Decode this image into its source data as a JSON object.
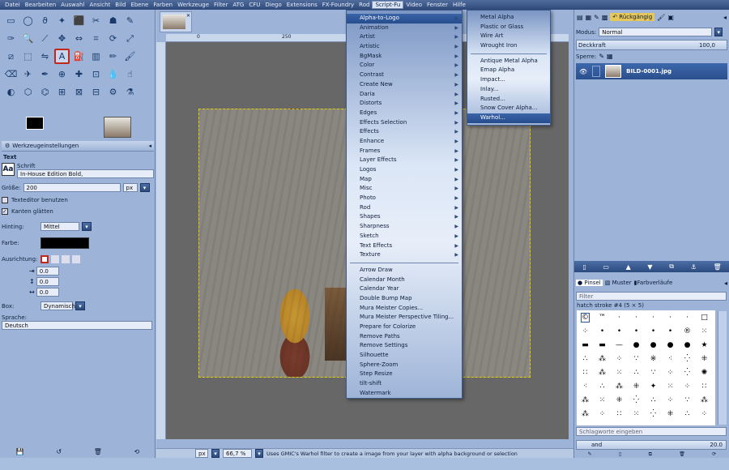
{
  "menubar": [
    "Datei",
    "Bearbeiten",
    "Auswahl",
    "Ansicht",
    "Bild",
    "Ebene",
    "Farben",
    "Werkzeuge",
    "Filter",
    "ATG",
    "CFU",
    "Diego",
    "Extensions",
    "FX-Foundry",
    "Rod",
    "Script-Fu",
    "Video",
    "Fenster",
    "Hilfe"
  ],
  "tool_icons": [
    "rect-select-icon",
    "ellipse-select-icon",
    "lasso-icon",
    "fuzzy-select-icon",
    "color-select-icon",
    "scissors-icon",
    "foreground-select-icon",
    "paths-icon",
    "color-picker-icon",
    "zoom-icon",
    "measure-icon",
    "move-icon",
    "align-icon",
    "crop-icon",
    "rotate-icon",
    "scale-icon",
    "shear-icon",
    "perspective-icon",
    "flip-icon",
    "text-icon",
    "bucket-fill-icon",
    "blend-icon",
    "pencil-icon",
    "paintbrush-icon",
    "eraser-icon",
    "airbrush-icon",
    "ink-icon",
    "clone-icon",
    "heal-icon",
    "perspective-clone-icon",
    "blur-icon",
    "smudge-icon",
    "dodge-burn-icon",
    "cage-icon",
    "warp-icon",
    "unified-transform-icon",
    "handle-transform-icon",
    "seamless-clone-icon",
    "gegl-icon",
    "filter-icon"
  ],
  "tool_glyphs": [
    "▭",
    "◯",
    "ϑ",
    "✦",
    "⬛",
    "✂",
    "☗",
    "✎",
    "✑",
    "🔍",
    "⟋",
    "✥",
    "⇔",
    "⌗",
    "⟳",
    "⤢",
    "⧄",
    "⬚",
    "⇋",
    "A",
    "⛽",
    "▥",
    "✏",
    "🖌",
    "⌫",
    "✈",
    "✒",
    "⊕",
    "✚",
    "⊡",
    "💧",
    "☝",
    "◐",
    "⬡",
    "⌬",
    "⊞",
    "⊠",
    "⊟",
    "⚙",
    "⚗"
  ],
  "tool_options": {
    "tab_label": "Werkzeugeinstellungen",
    "section": "Text",
    "font_label": "Schrift",
    "font_value": "In-House Edition Bold,",
    "size_label": "Größe:",
    "size_value": "200",
    "size_unit": "px",
    "use_editor": "Texteditor benutzen",
    "antialias": "Kanten glätten",
    "hinting_label": "Hinting:",
    "hinting_value": "Mittel",
    "color_label": "Farbe:",
    "justify_label": "Ausrichtung:",
    "indent_value": "0.0",
    "linespacing_value": "0.0",
    "letterspacing_value": "0.0",
    "box_label": "Box:",
    "box_value": "Dynamisch",
    "language_label": "Sprache:",
    "language_value": "Deutsch"
  },
  "ruler": {
    "t0": "0",
    "t250": "250"
  },
  "status": {
    "unit": "px",
    "zoom": "66,7 %",
    "message": "Uses GMIC's Warhol filter to create a image from your layer with alpha background or selection"
  },
  "scriptfu_menu": [
    "Alpha-to-Logo",
    "Animation",
    "Artist",
    "Artistic",
    "BgMask",
    "Color",
    "Contrast",
    "Create New",
    "Daria",
    "Distorts",
    "Edges",
    "Effects Selection",
    "Effects",
    "Enhance",
    "Frames",
    "Layer Effects",
    "Logos",
    "Map",
    "Misc",
    "Photo",
    "Rod",
    "Shapes",
    "Sharpness",
    "Sketch",
    "Text Effects",
    "Texture"
  ],
  "scriptfu_menu2": [
    "Arrow Draw",
    "Calendar Month",
    "Calendar Year",
    "Double Bump Map",
    "Mura Meister Copies...",
    "Mura Meister Perspective Tiling...",
    "Prepare for Colorize",
    "Remove Paths",
    "Remove Settings",
    "Silhouette",
    "Sphere-Zoom",
    "Step Resize",
    "tilt-shift",
    "Watermark"
  ],
  "submenu_a": [
    "Metal Alpha",
    "Plastic or Glass",
    "Wire Art",
    "Wrought Iron"
  ],
  "submenu_b": [
    "Antique Metal Alpha",
    "Emap Alpha",
    "Impact...",
    "Inlay...",
    "Rusted...",
    "Snow Cover Alpha...",
    "Warhol..."
  ],
  "layers": {
    "undo_label": "Rückgängig",
    "mode_label": "Modus:",
    "mode_value": "Normal",
    "opacity_label": "Deckkraft",
    "opacity_value": "100,0",
    "lock_label": "Sperre:",
    "layer_name": "BILD-0001.jpg"
  },
  "brushes": {
    "tabs": [
      "Pinsel",
      "Muster",
      "Farbverläufe"
    ],
    "filter_placeholder": "Filter",
    "brush_name": "hatch stroke #4 (5 × 5)",
    "tag_placeholder": "Schlagworte eingeben",
    "spacing_value": "and",
    "spacing_num": "20.0"
  },
  "colors": {
    "accent": "#c0281c",
    "menu_highlight": "#2c5296",
    "panel": "#9db4d8"
  }
}
